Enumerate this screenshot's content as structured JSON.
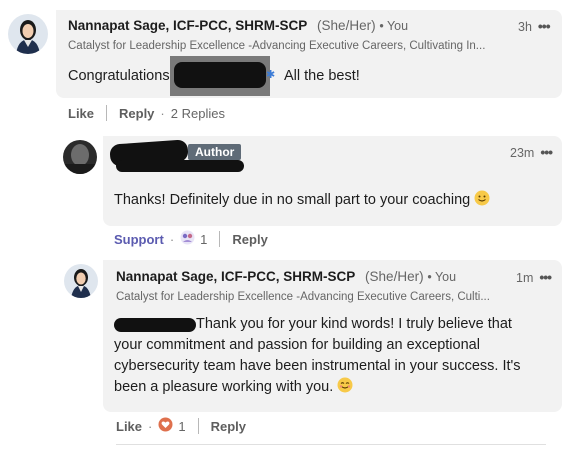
{
  "comment1": {
    "name": "Nannapat Sage, ICF-PCC, SHRM-SCP",
    "pronouns": "(She/Her)",
    "degree": "• You",
    "headline": "Catalyst for Leadership Excellence -Advancing Executive Careers, Cultivating In...",
    "time": "3h",
    "more": "•••",
    "text_before": "Congratulations",
    "text_after": "All the best!",
    "like": "Like",
    "reply": "Reply",
    "replies": "2 Replies"
  },
  "reply1": {
    "badge": "Author",
    "time": "23m",
    "more": "•••",
    "text": "Thanks! Definitely due in no small part to your coaching",
    "reaction_label": "Support",
    "reaction_count": "1",
    "reply": "Reply"
  },
  "reply2": {
    "name": "Nannapat Sage, ICF-PCC, SHRM-SCP",
    "pronouns": "(She/Her)",
    "degree": "• You",
    "headline": "Catalyst for Leadership Excellence -Advancing Executive Careers, Culti...",
    "time": "1m",
    "more": "•••",
    "line1": "Thank you for your kind words! I truly believe that",
    "line2": "your commitment and passion for building an exceptional",
    "line3": "cybersecurity team have been instrumental in your success. It's",
    "line4": "been a pleasure working with you.",
    "like": "Like",
    "reaction_count": "1",
    "reply": "Reply"
  },
  "icons": {
    "avatar": "profile-photo",
    "smile": "slightly-smiling-face-emoji",
    "support": "support-reaction-icon",
    "love": "love-reaction-icon",
    "more": "more-options-icon"
  }
}
